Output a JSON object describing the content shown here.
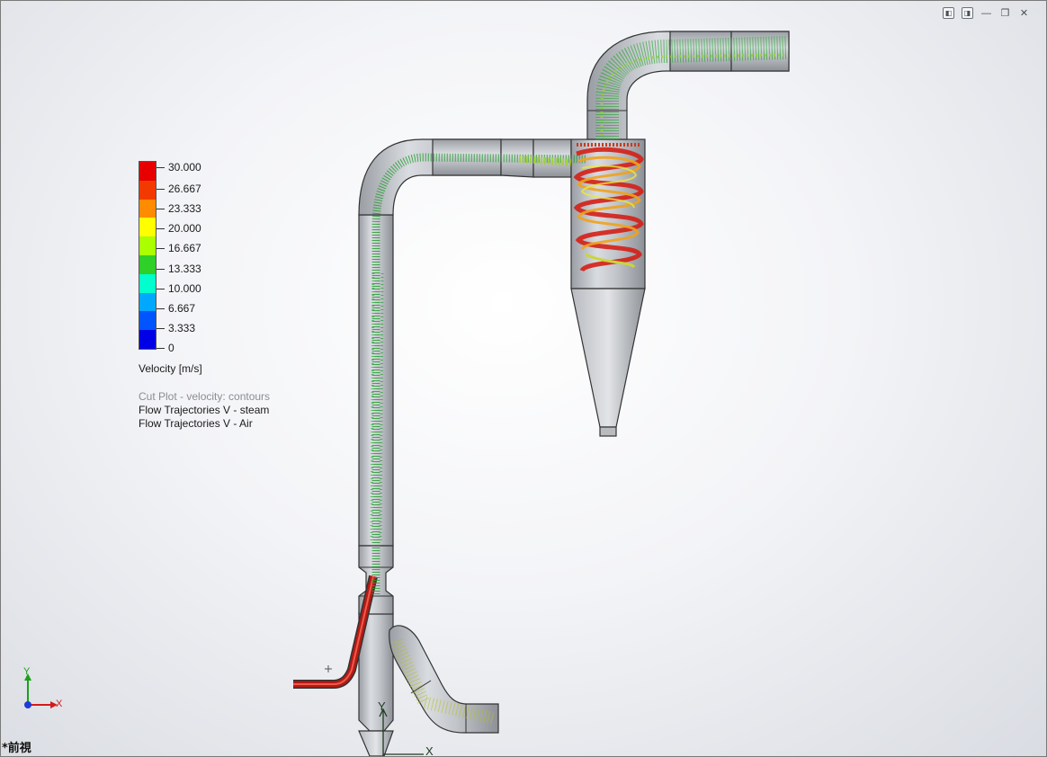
{
  "window_controls": [
    {
      "name": "view-left-button",
      "glyph": "◧"
    },
    {
      "name": "view-right-button",
      "glyph": "◨"
    },
    {
      "name": "minimize-button",
      "glyph": "—"
    },
    {
      "name": "restore-button",
      "glyph": "❐"
    },
    {
      "name": "close-button",
      "glyph": "✕"
    }
  ],
  "legend": {
    "ticks": [
      "30.000",
      "26.667",
      "23.333",
      "20.000",
      "16.667",
      "13.333",
      "10.000",
      "6.667",
      "3.333",
      "0"
    ],
    "colors": [
      "#e60000",
      "#f23a00",
      "#ff8c00",
      "#ffff00",
      "#aaff00",
      "#2fd028",
      "#00ffcc",
      "#00a8ff",
      "#0055ff",
      "#0000e6"
    ],
    "title": "Velocity [m/s]"
  },
  "plot_info": {
    "cut_plot": "Cut Plot - velocity: contours",
    "traj_steam": "Flow Trajectories V - steam",
    "traj_air": "Flow Trajectories V - Air"
  },
  "triad": {
    "y_label": "Y",
    "x_label": "X",
    "y_color": "#1aa01a",
    "x_color": "#d01c1c",
    "z_color": "#1f3bd6"
  },
  "origin_axes": {
    "y_label": "Y",
    "x_label": "X"
  },
  "view_name": "*前視"
}
